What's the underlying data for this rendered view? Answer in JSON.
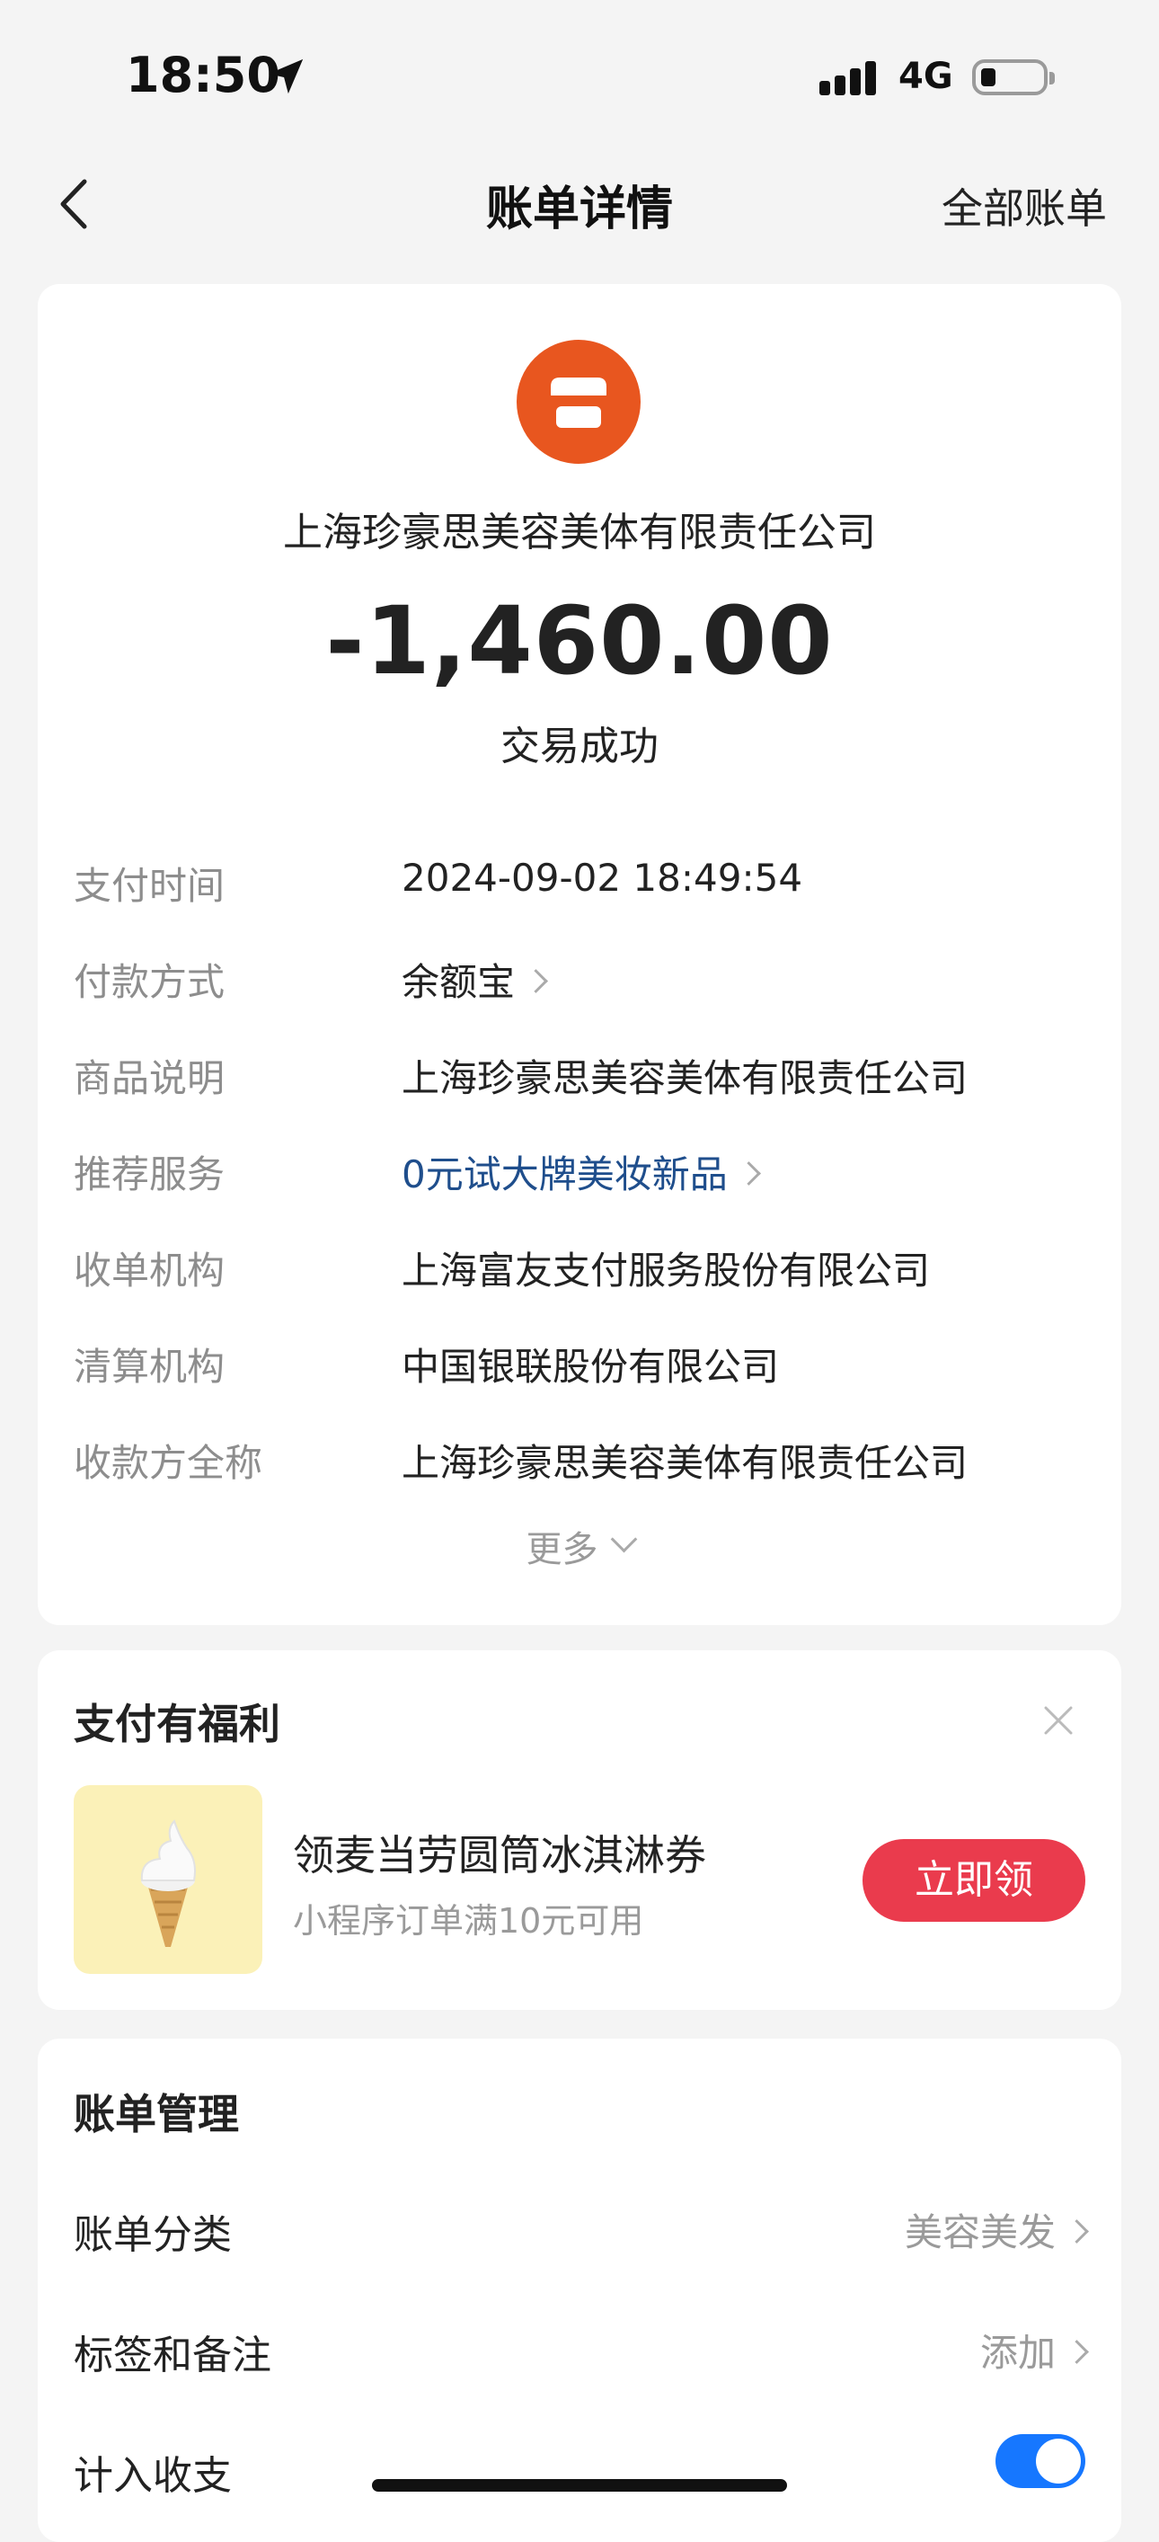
{
  "status_bar": {
    "time": "18:50",
    "network": "4G"
  },
  "nav": {
    "title": "账单详情",
    "right_link": "全部账单"
  },
  "transaction": {
    "merchant": "上海珍豪思美容美体有限责任公司",
    "amount": "-1,460.00",
    "status": "交易成功"
  },
  "details": [
    {
      "label": "支付时间",
      "value": "2024-09-02 18:49:54"
    },
    {
      "label": "付款方式",
      "value": "余额宝"
    },
    {
      "label": "商品说明",
      "value": "上海珍豪思美容美体有限责任公司"
    },
    {
      "label": "推荐服务",
      "value": "0元试大牌美妆新品"
    },
    {
      "label": "收单机构",
      "value": "上海富友支付服务股份有限公司"
    },
    {
      "label": "清算机构",
      "value": "中国银联股份有限公司"
    },
    {
      "label": "收款方全称",
      "value": "上海珍豪思美容美体有限责任公司"
    }
  ],
  "more_label": "更多",
  "promo": {
    "section_title": "支付有福利",
    "title": "领麦当劳圆筒冰淇淋券",
    "subtitle": "小程序订单满10元可用",
    "button": "立即领"
  },
  "manage": {
    "section_title": "账单管理",
    "category_label": "账单分类",
    "category_value": "美容美发",
    "tags_label": "标签和备注",
    "tags_value": "添加",
    "include_label": "计入收支",
    "include_on": true
  },
  "colors": {
    "accent": "#1677ff",
    "merchant_icon": "#e8561f",
    "claim_button": "#ea3b4d",
    "link": "#1f4e8c"
  }
}
